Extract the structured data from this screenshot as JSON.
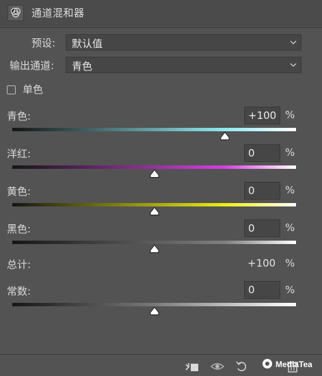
{
  "header": {
    "title": "通道混和器",
    "icon": "channel-mixer-icon"
  },
  "preset": {
    "label": "预设:",
    "value": "默认值"
  },
  "output_channel": {
    "label": "输出通道:",
    "value": "青色"
  },
  "monochrome": {
    "label": "单色",
    "checked": false
  },
  "sliders": [
    {
      "label": "青色:",
      "value": "+100",
      "unit": "%",
      "level": 100,
      "gradient": [
        "#151515",
        "#8feaf0",
        "#ffffff"
      ]
    },
    {
      "label": "洋红:",
      "value": "0",
      "unit": "%",
      "level": 0,
      "gradient": [
        "#151515",
        "#d63fe0",
        "#ffffff"
      ]
    },
    {
      "label": "黄色:",
      "value": "0",
      "unit": "%",
      "level": 0,
      "gradient": [
        "#151515",
        "#eeee10",
        "#ffffff"
      ]
    },
    {
      "label": "黑色:",
      "value": "0",
      "unit": "%",
      "level": 0,
      "gradient": [
        "#151515",
        "#808080",
        "#ffffff"
      ]
    }
  ],
  "total": {
    "label": "总计:",
    "value": "+100",
    "unit": "%"
  },
  "constant": {
    "label": "常数:",
    "value": "0",
    "unit": "%",
    "level": 0
  },
  "toolbar": {
    "icons": [
      "clip-to-layer-icon",
      "visibility-icon",
      "reset-icon",
      "delete-icon"
    ]
  },
  "watermark": {
    "text": "MediaTea"
  }
}
